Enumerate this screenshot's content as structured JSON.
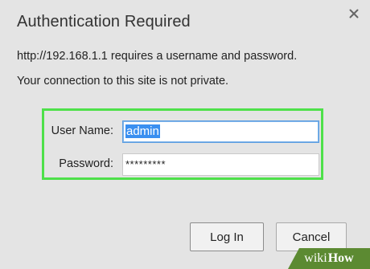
{
  "dialog": {
    "title": "Authentication Required",
    "message_line1": "http://192.168.1.1 requires a username and password.",
    "message_line2": "Your connection to this site is not private.",
    "close_icon": "close-icon"
  },
  "form": {
    "username_label": "User Name:",
    "username_value": "admin",
    "password_label": "Password:",
    "password_value": "*********",
    "highlight_color": "#4ee04a"
  },
  "buttons": {
    "login_label": "Log In",
    "cancel_label": "Cancel"
  },
  "watermark": {
    "part1": "wiki",
    "part2": "How"
  }
}
